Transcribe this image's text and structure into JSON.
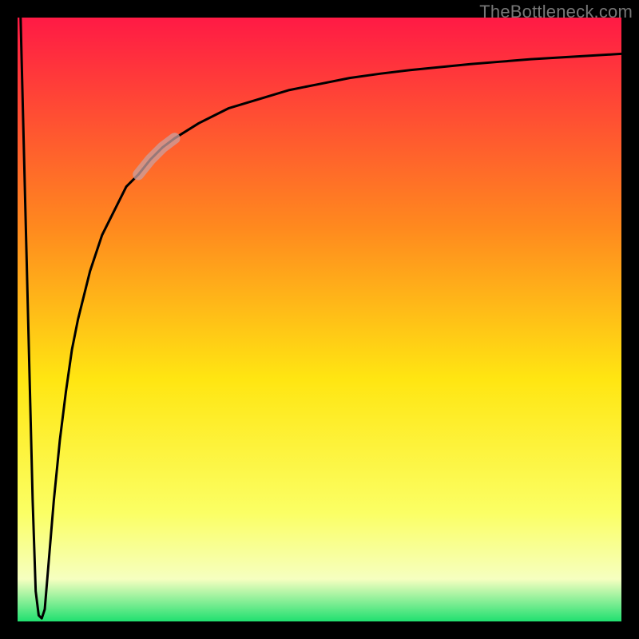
{
  "watermark": "TheBottleneck.com",
  "colors": {
    "frame": "#000000",
    "curve": "#000000",
    "highlight": "#caa0a0",
    "grad_top": "#ff1a45",
    "grad_mid_upper": "#ff8a1e",
    "grad_mid": "#ffe612",
    "grad_mid_lower": "#fbff64",
    "grad_low": "#f6ffc0",
    "grad_bottom": "#20e070"
  },
  "chart_data": {
    "type": "line",
    "title": "",
    "xlabel": "",
    "ylabel": "",
    "xlim": [
      0,
      100
    ],
    "ylim": [
      0,
      100
    ],
    "grid": false,
    "notes": "Vertical gradient background red→yellow→green (top→bottom). Black curve dips to ~0 near x≈4 then rises toward ~94 at right edge. No axis ticks or labels shown.",
    "series": [
      {
        "name": "curve",
        "x": [
          0.5,
          1,
          1.5,
          2,
          2.5,
          3,
          3.5,
          4,
          4.5,
          5,
          6,
          7,
          8,
          9,
          10,
          12,
          14,
          16,
          18,
          20,
          22,
          24,
          26,
          30,
          35,
          40,
          45,
          50,
          55,
          60,
          65,
          70,
          75,
          80,
          85,
          90,
          95,
          100
        ],
        "values": [
          100,
          80,
          60,
          40,
          20,
          5,
          1,
          0.5,
          2,
          8,
          20,
          30,
          38,
          45,
          50,
          58,
          64,
          68,
          72,
          74,
          76.5,
          78.5,
          80,
          82.5,
          85,
          86.5,
          88,
          89,
          90,
          90.7,
          91.3,
          91.8,
          92.3,
          92.7,
          93.1,
          93.4,
          93.7,
          94
        ]
      },
      {
        "name": "highlight-segment",
        "x": [
          20,
          22,
          24,
          26
        ],
        "values": [
          74,
          76.5,
          78.5,
          80
        ]
      }
    ]
  }
}
